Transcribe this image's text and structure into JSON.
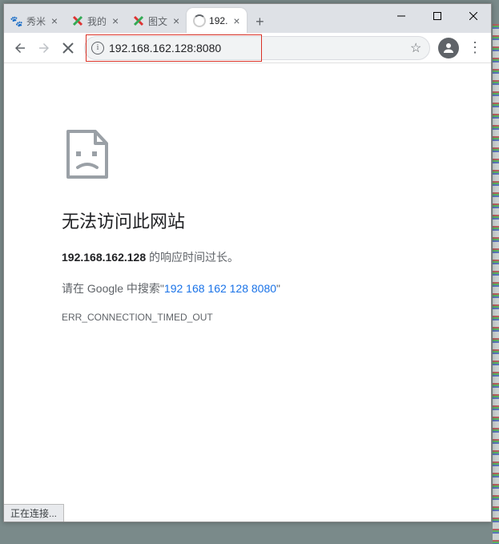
{
  "tabs": [
    {
      "title": "秀米",
      "icon": "🐾"
    },
    {
      "title": "我的",
      "icon": "x"
    },
    {
      "title": "图文",
      "icon": "x"
    },
    {
      "title": "192.",
      "icon": "spin",
      "active": true
    }
  ],
  "omni": {
    "url": "192.168.162.128:8080"
  },
  "error": {
    "title": "无法访问此网站",
    "host": "192.168.162.128",
    "host_suffix": " 的响应时间过长。",
    "search_prefix": "请在 Google 中搜索\"",
    "search_link": "192 168 162 128 8080",
    "search_suffix": "\"",
    "code": "ERR_CONNECTION_TIMED_OUT"
  },
  "status": "正在连接...",
  "icons": {
    "newtab": "+"
  }
}
